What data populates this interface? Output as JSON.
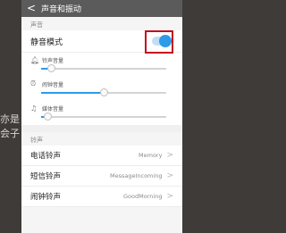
{
  "background": {
    "text": "亦是 会子"
  },
  "header": {
    "back_icon": "back-arrow-icon",
    "title": "声音和振动"
  },
  "sections": {
    "sound_label": "声音",
    "ringtone_label": "铃声"
  },
  "silent_mode": {
    "label": "静音模式",
    "on": true
  },
  "volumes": [
    {
      "label": "铃声音量",
      "icon": "bell-icon",
      "level": 0.08
    },
    {
      "label": "闹钟音量",
      "icon": "alarm-clock-icon",
      "level": 0.5
    },
    {
      "label": "媒体音量",
      "icon": "music-note-icon",
      "level": 0.05
    }
  ],
  "ringtones": [
    {
      "title": "电话铃声",
      "value": "Memory"
    },
    {
      "title": "短信铃声",
      "value": "MessageIncoming"
    },
    {
      "title": "闹钟铃声",
      "value": "GoodMorning"
    }
  ],
  "colors": {
    "accent": "#2f9ae8",
    "highlight_box": "#c30e1c",
    "header_bg": "#5b5b5b"
  }
}
